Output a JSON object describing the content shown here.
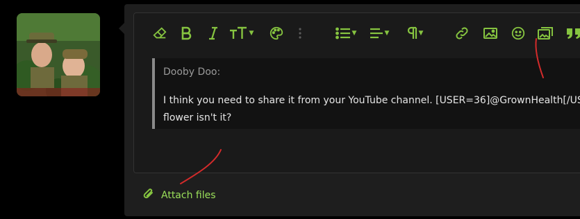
{
  "avatar": {
    "alt_icon": "user-avatar"
  },
  "toolbar": {
    "icons": [
      "eraser-icon",
      "bold-icon",
      "italic-icon",
      "text-size-icon",
      "palette-icon",
      "more-vertical-icon",
      "list-icon",
      "align-icon",
      "paragraph-icon",
      "link-icon",
      "image-icon",
      "smiley-icon",
      "media-icon",
      "quote-icon"
    ]
  },
  "quote": {
    "author": "Dooby Doo:",
    "line1": "I think you need to share it from your YouTube channel. [USER=36]@GrownHealth[/US",
    "line2": "flower isn't it?"
  },
  "attach": {
    "label": "Attach files"
  },
  "colors": {
    "accent": "#86c440",
    "annotation": "#d42b2b",
    "background": "#000000",
    "panel": "#1e1e1e"
  }
}
